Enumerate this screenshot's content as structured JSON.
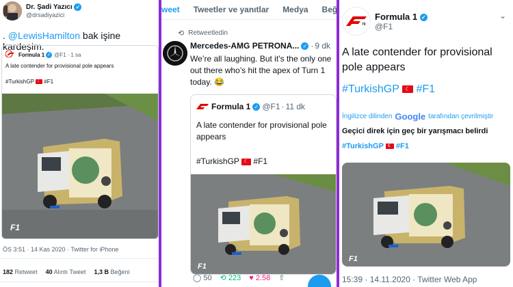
{
  "panel1": {
    "name": "Dr. Şadi Yazıcı",
    "handle": "@drsadiyazici",
    "reply_prefix": ".",
    "mention": "@LewisHamilton",
    "reply_text": "bak işine kardeşim.",
    "quote": {
      "name": "Formula 1",
      "handle": "@F1",
      "sep": "·",
      "time": "1 sa",
      "text": "A late contender for provisional pole appears",
      "hashtag1": "#TurkishGP",
      "hashtag2": "#F1"
    },
    "meta": "ÖS 3:51 · 14 Kas 2020 · Twitter for iPhone",
    "stats": [
      {
        "value": "182",
        "label": "Retweet"
      },
      {
        "value": "40",
        "label": "Alıntı Tweet"
      },
      {
        "value": "1,3 B",
        "label": "Beğeni"
      }
    ]
  },
  "panel2": {
    "tabs": [
      "weet",
      "Tweetler ve yanıtlar",
      "Medya",
      "Beğe"
    ],
    "retweeted_by": "Retweetledin",
    "name": "Mercedes-AMG PETRONA...",
    "sep": "·",
    "time": "9 dk",
    "text": "We’re all laughing. But it’s the only one out there who’s hit the apex of Turn 1 today. 😂",
    "quote": {
      "name": "Formula 1",
      "handle": "@F1",
      "sep": "·",
      "time": "11 dk",
      "text": "A late contender for provisional pole appears",
      "hashtag1": "#TurkishGP",
      "hashtag2": "#F1"
    },
    "actions": {
      "replies": "50",
      "retweets": "223",
      "likes": "2.58"
    }
  },
  "panel3": {
    "name": "Formula 1",
    "handle": "@F1",
    "text": "A late contender for provisional pole appears",
    "hashtag1": "#TurkishGP",
    "hashtag2": "#F1",
    "translate_prefix": "İngilizce dilinden",
    "translate_brand": "Google",
    "translate_suffix": "tarafından çevrilmiştir",
    "translated_text": "Geçici direk için geç bir yarışmacı belirdi",
    "translated_tag1": "#TurkishGP",
    "translated_tag2": "#F1",
    "meta": "15:39 · 14.11.2020 · Twitter Web App"
  },
  "colors": {
    "accent": "#1d9bf0",
    "divider": "#8e2bd6",
    "f1red": "#e10600",
    "flag": "#e30a17",
    "retweet": "#00ba7c",
    "like": "#f91880"
  }
}
